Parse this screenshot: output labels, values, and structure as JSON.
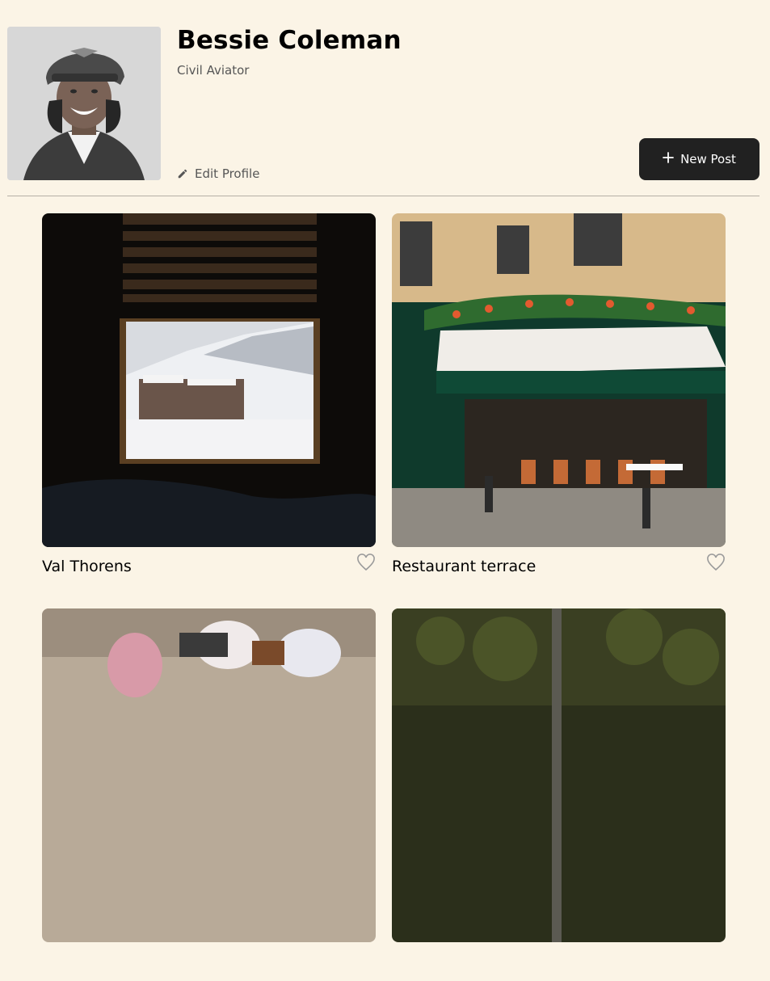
{
  "profile": {
    "name": "Bessie Coleman",
    "role": "Civil Aviator",
    "edit_label": "Edit Profile",
    "avatar_alt": "profile photo"
  },
  "toolbar": {
    "new_post_label": "New Post"
  },
  "cards": [
    {
      "title": "Val Thorens",
      "image": "window view of snowy ski resort",
      "liked": false
    },
    {
      "title": "Restaurant terrace",
      "image": "Paris cafe with green awning",
      "liked": false
    },
    {
      "title": "",
      "image": "people at cafe tables",
      "liked": false
    },
    {
      "title": "",
      "image": "forest with tall tree",
      "liked": false
    }
  ],
  "icons": {
    "edit": "pencil-icon",
    "new_post": "plus-icon",
    "like": "heart-icon"
  },
  "colors": {
    "background": "#fbf4e6",
    "button": "#212121",
    "muted_text": "#565656"
  }
}
